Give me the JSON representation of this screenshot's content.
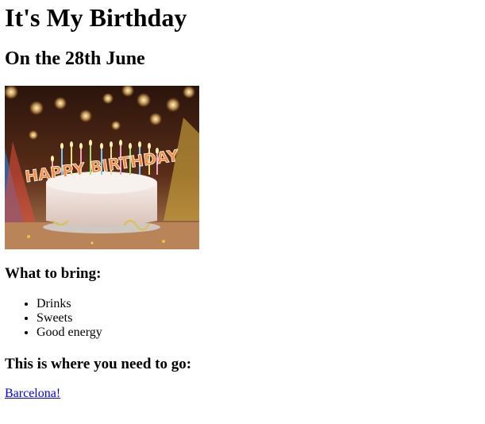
{
  "page": {
    "title": "It's My Birthday",
    "subtitle": "On the 28th June"
  },
  "photo": {
    "alt": "birthday-cake-photo",
    "cake_text": "HAPPY BIRTHDAY",
    "colors": {
      "background_dark": "#3a1d12",
      "background_warm": "#8a4a24",
      "cake_frosting": "#efe2dc",
      "table": "#b5835a"
    }
  },
  "bring": {
    "heading": "What to bring:",
    "items": [
      "Drinks",
      "Sweets",
      "Good energy"
    ]
  },
  "location": {
    "heading": "This is where you need to go:",
    "link_text": "Barcelona!"
  },
  "colors": {
    "link": "#0000ee",
    "text": "#000000",
    "background": "#ffffff"
  }
}
